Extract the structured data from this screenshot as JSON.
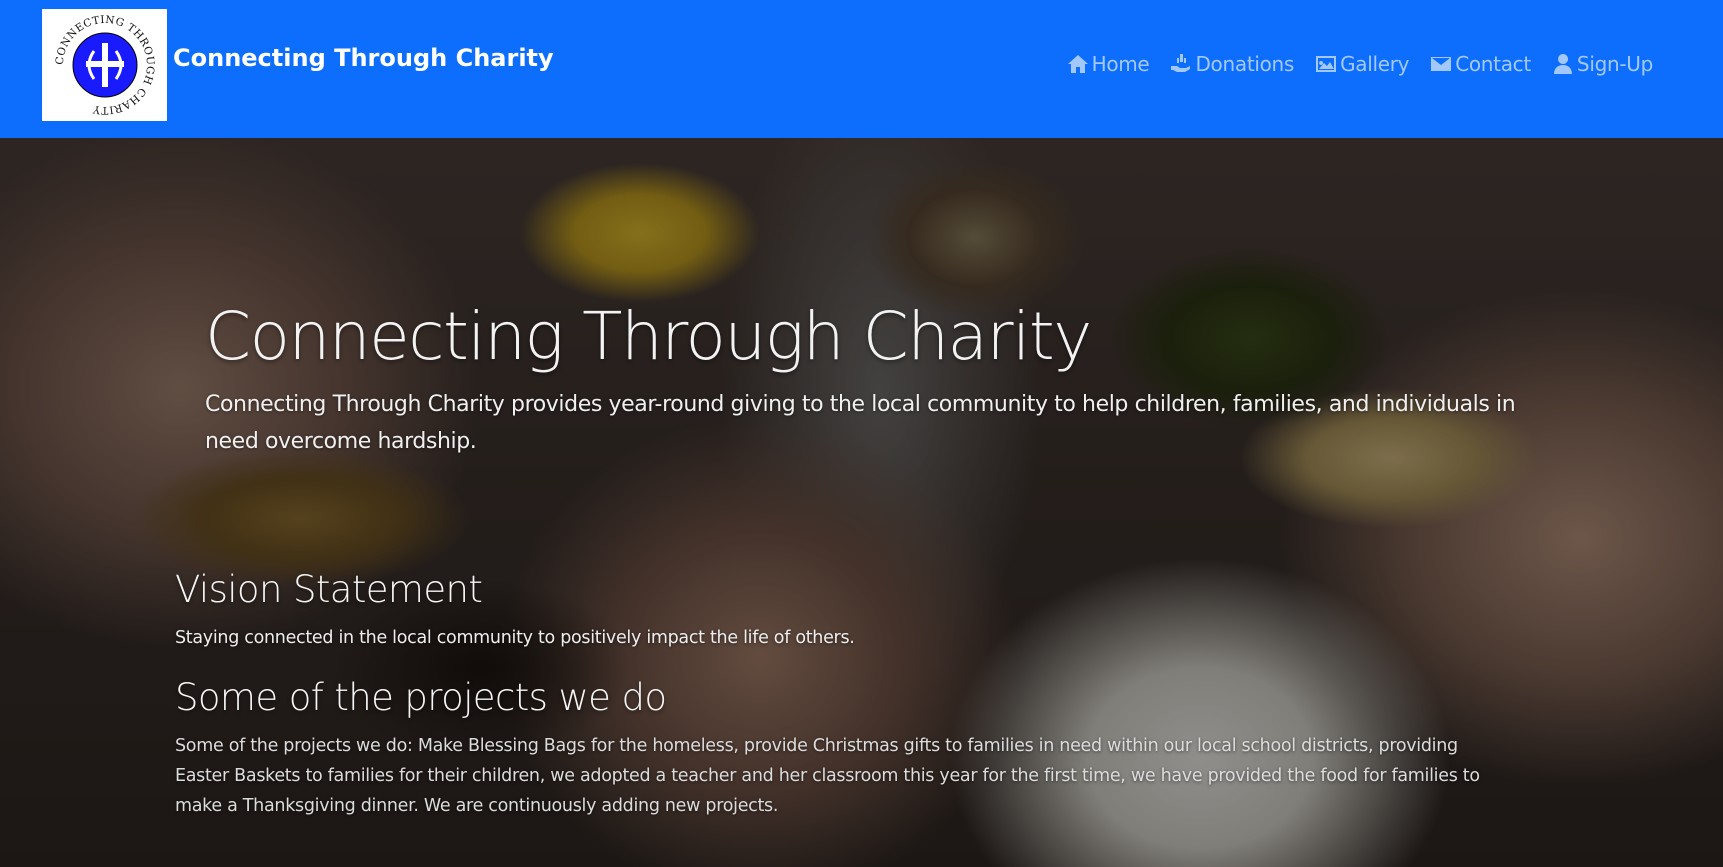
{
  "navbar": {
    "logo_text": "CONNECTING THROUGH CHARITY",
    "brand": "Connecting Through Charity",
    "items": [
      {
        "label": "Home",
        "icon": "house-icon"
      },
      {
        "label": "Donations",
        "icon": "hand-donation-icon"
      },
      {
        "label": "Gallery",
        "icon": "image-icon"
      },
      {
        "label": "Contact",
        "icon": "envelope-icon"
      },
      {
        "label": "Sign-Up",
        "icon": "person-icon"
      }
    ]
  },
  "hero": {
    "title": "Connecting Through Charity",
    "lead": "Connecting Through Charity provides year-round giving to the local community to help children, families, and individuals in need overcome hardship.",
    "background_image": "hands-holding-grains-photo"
  },
  "vision": {
    "heading": "Vision Statement",
    "text": "Staying connected in the local community to positively impact the life of others."
  },
  "projects": {
    "heading": "Some of the projects we do",
    "text": "Some of the projects we do: Make Blessing Bags for the homeless, provide Christmas gifts to families in need within our local school districts, providing Easter Baskets to families for their children, we adopted a teacher and her classroom this year for the first time, we have provided the food for families to make a Thanksgiving dinner. We are continuously adding new projects."
  },
  "colors": {
    "navbar_bg": "#0d6efd",
    "logo_circle": "#1a1aff"
  }
}
